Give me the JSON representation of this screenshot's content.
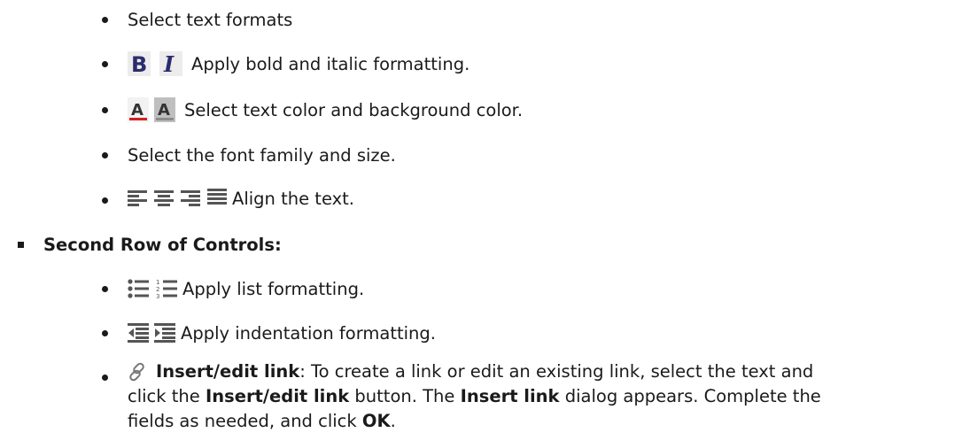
{
  "items": {
    "select_formats": "Select text formats",
    "bold_italic": "Apply bold and italic formatting.",
    "color": "Select text color and background color.",
    "font": "Select the font family and size.",
    "align": "Align the text.",
    "second_row_heading": "Second Row of Controls:",
    "list": "Apply list formatting.",
    "indent": "Apply indentation formatting.",
    "link": {
      "title": "Insert/edit link",
      "text1": ": To create a link or edit an existing link, select the text and",
      "text2_prefix": "click the ",
      "button_name": "Insert/edit link",
      "text2_mid": " button. The ",
      "dialog_name": "Insert link",
      "text2_suffix": " dialog appears. Complete the",
      "text3_prefix": "fields as needed, and click ",
      "ok": "OK",
      "text3_suffix": "."
    }
  },
  "icons": {
    "bold": "bold-icon",
    "italic": "italic-icon",
    "text_color": "text-color-icon",
    "background_color": "background-color-icon",
    "align_left": "align-left-icon",
    "align_center": "align-center-icon",
    "align_right": "align-right-icon",
    "align_justify": "align-justify-icon",
    "bullet_list": "bullet-list-icon",
    "numbered_list": "numbered-list-icon",
    "outdent": "outdent-icon",
    "indent": "indent-icon",
    "link": "link-icon"
  },
  "colors": {
    "text": "#1a1a1a",
    "text_color_underline": "#d42020",
    "icon_gray": "#555555",
    "bold_icon": "#2b2b6e"
  }
}
